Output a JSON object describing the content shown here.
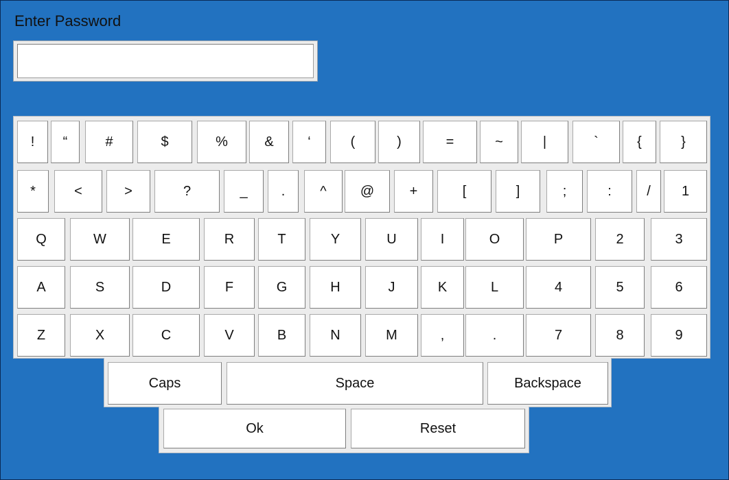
{
  "header": {
    "title": "Enter Password"
  },
  "password": {
    "value": ""
  },
  "keyboard": {
    "rows": [
      [
        "!",
        "“",
        "#",
        "$",
        "%",
        "&",
        "‘",
        "(",
        ")",
        "=",
        "~",
        "|",
        "`",
        "{",
        "}"
      ],
      [
        "*",
        "<",
        ">",
        "?",
        "_",
        ".",
        "^",
        "@",
        "+",
        "[",
        "]",
        ";",
        ":",
        "/",
        "1"
      ],
      [
        "Q",
        "W",
        "E",
        "R",
        "T",
        "Y",
        "U",
        "I",
        "O",
        "P",
        "2",
        "3"
      ],
      [
        "A",
        "S",
        "D",
        "F",
        "G",
        "H",
        "J",
        "K",
        "L",
        "4",
        "5",
        "6"
      ],
      [
        "Z",
        "X",
        "C",
        "V",
        "B",
        "N",
        "M",
        ",",
        ".",
        "7",
        "8",
        "9"
      ]
    ]
  },
  "controls": {
    "caps": "Caps",
    "space": "Space",
    "backspace": "Backspace",
    "ok": "Ok",
    "reset": "Reset"
  }
}
